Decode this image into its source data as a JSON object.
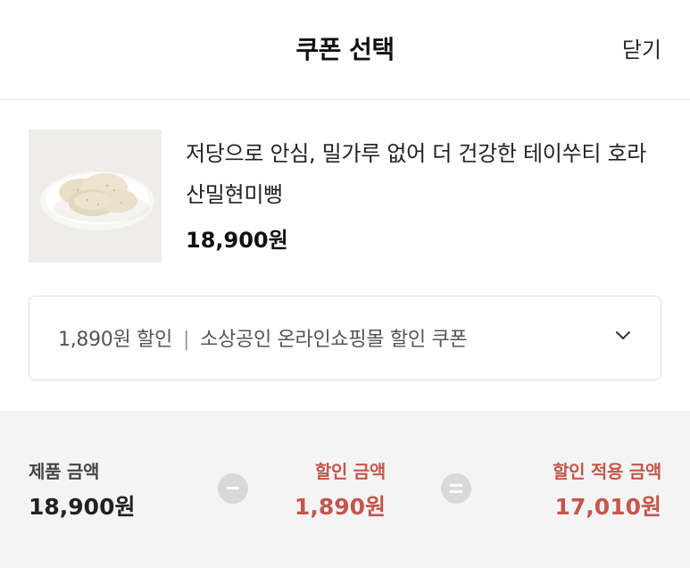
{
  "header": {
    "title": "쿠폰 선택",
    "close_label": "닫기"
  },
  "product": {
    "name": "저당으로 안심, 밀가루 없어 더 건강한 테이쑤티 호라산밀현미뻥",
    "price": "18,900원"
  },
  "coupon": {
    "discount": "1,890원 할인",
    "separator": "|",
    "name": "소상공인 온라인쇼핑몰 할인 쿠폰"
  },
  "summary": {
    "product_amount_label": "제품 금액",
    "product_amount_value": "18,900원",
    "discount_amount_label": "할인 금액",
    "discount_amount_value": "1,890원",
    "final_amount_label": "할인 적용 금액",
    "final_amount_value": "17,010원"
  },
  "colors": {
    "accent_red": "#c4574b",
    "operator_circle": "#d9d9d9",
    "summary_bg": "#f4f4f4"
  },
  "icons": [
    "chevron-down-icon",
    "minus-icon",
    "equals-icon"
  ]
}
